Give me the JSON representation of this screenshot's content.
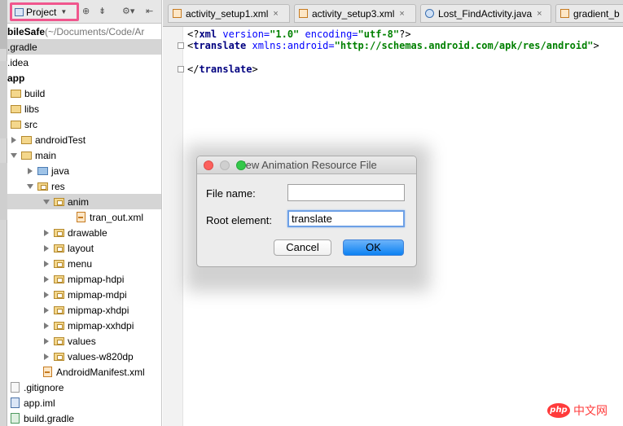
{
  "project_panel": {
    "selector_label": "Project",
    "toolbar_icons": [
      "target-icon",
      "collapse-icon",
      "gear-icon",
      "hide-icon"
    ],
    "tree": [
      {
        "label": "bileSafe",
        "suffix": " (~/Documents/Code/Ar",
        "type": "root",
        "bold": true
      },
      {
        "label": ".gradle",
        "type": "folder",
        "selected": true
      },
      {
        "label": ".idea",
        "type": "folder"
      },
      {
        "label": "app",
        "type": "folder",
        "bold": true
      },
      {
        "label": "build",
        "type": "folder"
      },
      {
        "label": "libs",
        "type": "folder"
      },
      {
        "label": "src",
        "type": "folder"
      },
      {
        "label": "androidTest",
        "type": "folder",
        "expander": "right"
      },
      {
        "label": "main",
        "type": "folder",
        "expander": "down"
      },
      {
        "label": "java",
        "type": "source-folder",
        "expander": "right"
      },
      {
        "label": "res",
        "type": "folder",
        "expander": "down"
      },
      {
        "label": "anim",
        "type": "package",
        "expander": "down",
        "selected": true
      },
      {
        "label": "tran_out.xml",
        "type": "xml"
      },
      {
        "label": "drawable",
        "type": "package",
        "expander": "right"
      },
      {
        "label": "layout",
        "type": "package",
        "expander": "right"
      },
      {
        "label": "menu",
        "type": "package",
        "expander": "right"
      },
      {
        "label": "mipmap-hdpi",
        "type": "package",
        "expander": "right"
      },
      {
        "label": "mipmap-mdpi",
        "type": "package",
        "expander": "right"
      },
      {
        "label": "mipmap-xhdpi",
        "type": "package",
        "expander": "right"
      },
      {
        "label": "mipmap-xxhdpi",
        "type": "package",
        "expander": "right"
      },
      {
        "label": "values",
        "type": "package",
        "expander": "right"
      },
      {
        "label": "values-w820dp",
        "type": "package",
        "expander": "right"
      },
      {
        "label": "AndroidManifest.xml",
        "type": "xml"
      },
      {
        "label": ".gitignore",
        "type": "file"
      },
      {
        "label": "app.iml",
        "type": "iml"
      },
      {
        "label": "build.gradle",
        "type": "gradle"
      }
    ]
  },
  "tabs": [
    {
      "label": "activity_setup1.xml",
      "icon": "xml-file-icon",
      "close": "×"
    },
    {
      "label": "activity_setup3.xml",
      "icon": "xml-file-icon",
      "close": "×"
    },
    {
      "label": "Lost_FindActivity.java",
      "icon": "java-class-icon",
      "close": "×"
    },
    {
      "label": "gradient_b",
      "icon": "xml-file-icon",
      "close": ""
    }
  ],
  "editor": {
    "line1": {
      "p1": "<?",
      "p2": "xml ",
      "p3": "version=",
      "p4": "\"1.0\"",
      "p5": " encoding=",
      "p6": "\"utf-8\"",
      "p7": "?>"
    },
    "line2": {
      "p1": "<",
      "p2": "translate ",
      "p3": "xmlns:android=",
      "p4": "\"http://schemas.android.com/apk/res/android\"",
      "p5": ">"
    },
    "line3": {
      "p1": "</",
      "p2": "translate",
      "p3": ">"
    }
  },
  "dialog": {
    "title": "New Animation Resource File",
    "file_name_label": "File name:",
    "file_name_value": "",
    "root_element_label": "Root element:",
    "root_element_value": "translate",
    "cancel_label": "Cancel",
    "ok_label": "OK",
    "traffic_lights": {
      "close": "#fc605c",
      "minimize": "#cfcfcf",
      "zoom": "#34c84a"
    }
  },
  "watermark": {
    "logo_text": "php",
    "site_text": "中文网"
  },
  "colors": {
    "highlight_border": "#f0568d",
    "selection_bg": "#d5d5d5",
    "ok_button": "#1a87f4"
  }
}
